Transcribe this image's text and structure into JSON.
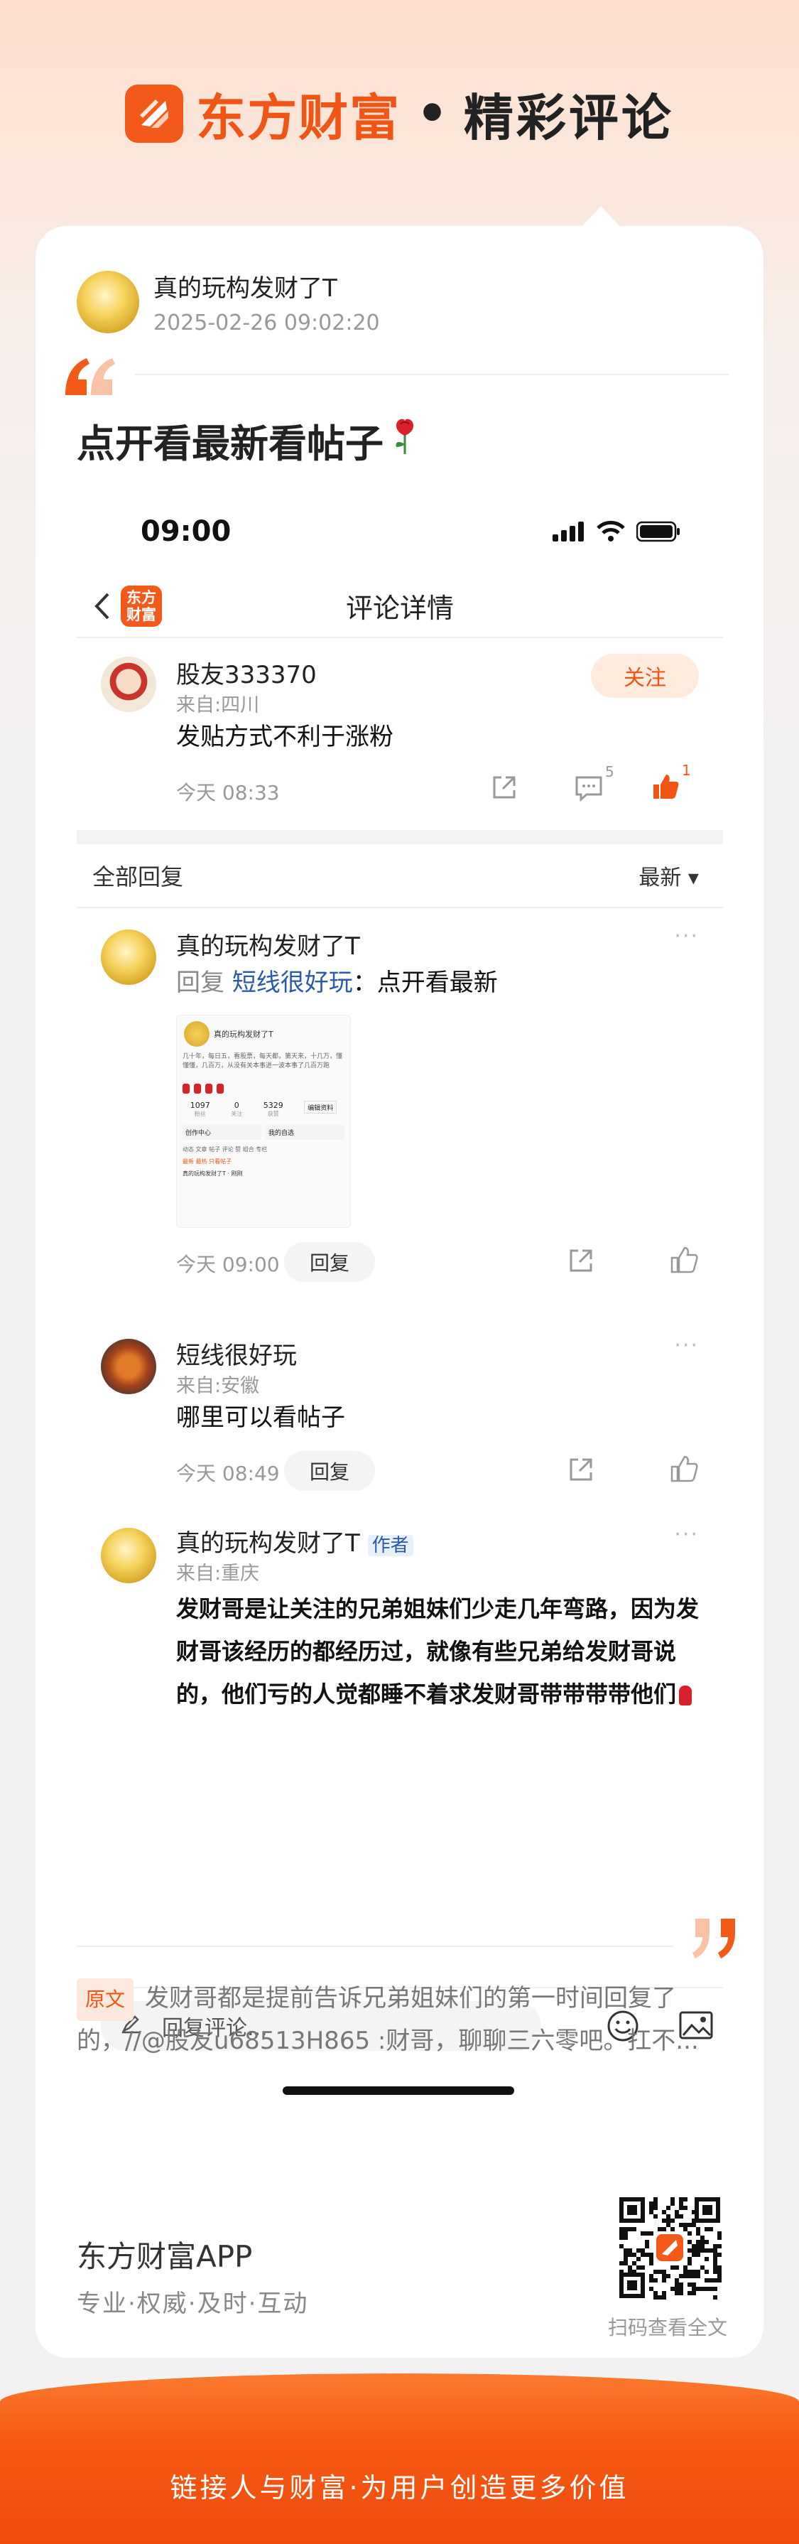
{
  "header": {
    "brand_name": "东方财富",
    "separator": "•",
    "section": "精彩评论"
  },
  "poster": {
    "name": "真的玩构发财了T",
    "time": "2025-02-26 09:02:20",
    "title": "点开看最新看帖子"
  },
  "screenshot": {
    "status_time": "09:00",
    "nav_logo_text": "东方\n财富",
    "nav_title": "评论详情",
    "main_comment": {
      "name": "股友333370",
      "from": "来自:四川",
      "text": "发贴方式不利于涨粉",
      "time": "今天 08:33",
      "follow_label": "关注",
      "comment_count": "5",
      "like_count": "1"
    },
    "replies_header": {
      "title": "全部回复",
      "sort": "最新 ▾"
    },
    "replies": [
      {
        "name": "真的玩构发财了T",
        "reply_prefix": "回复 ",
        "reply_to": "短线很好玩",
        "reply_text": "：点开看最新",
        "time": "今天 09:00",
        "reply_label": "回复",
        "more": "···"
      },
      {
        "name": "短线很好玩",
        "from": "来自:安徽",
        "text": "哪里可以看帖子",
        "time": "今天 08:49",
        "reply_label": "回复",
        "more": "···"
      },
      {
        "name": "真的玩构发财了T",
        "author_tag": "作者",
        "from": "来自:重庆",
        "text": "发财哥是让关注的兄弟姐妹们少走几年弯路，因为发财哥该经历的都经历过，就像有些兄弟给发财哥说的，他们亏的人觉都睡不着求发财哥带带带带他们",
        "more": "···"
      }
    ],
    "thumbnail": {
      "name": "真的玩构发财了T",
      "bio": "几十年，每日五，看股票，每天都，第天来，十几万，懂懂懂，几百万，从没有关本事进一波本事了几百万跑",
      "stats": [
        {
          "value": "1097",
          "label": "粉丝"
        },
        {
          "value": "0",
          "label": "关注"
        },
        {
          "value": "5329",
          "label": "获赞"
        }
      ],
      "edit_label": "编辑资料",
      "menu_a": "创作中心",
      "menu_b": "我的自选",
      "tabs": "动态  文章  帖子  评论  赞  组合  专栏",
      "sub_tabs": "最新  最热  只看帖子",
      "post_line": "真的玩构发财了T · 刚刚"
    },
    "input_placeholder": "回复评论..."
  },
  "original": {
    "tag": "原文",
    "text": "发财哥都是提前告诉兄弟姐妹们的第一时间回复了的，//@股友u68513H865 :财哥，聊聊三六零吧。扛不..."
  },
  "app": {
    "name": "东方财富APP",
    "slogan": "专业·权威·及时·互动",
    "qr_caption": "扫码查看全文"
  },
  "footer": {
    "text": "链接人与财富·为用户创造更多价值"
  },
  "colors": {
    "brand": "#f05516",
    "link": "#2b5aa8",
    "like_active": "#f05516"
  }
}
